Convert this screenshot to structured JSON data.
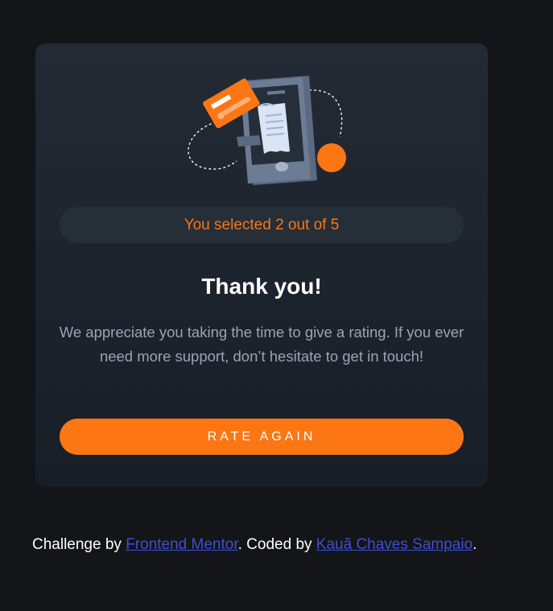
{
  "card": {
    "result_text": "You selected 2 out of 5",
    "title": "Thank you!",
    "description": "We appreciate you taking the time to give a rating. If you ever need more support, don’t hesitate to get in touch!",
    "button_label": "RATE AGAIN",
    "illustration_icon": "phone-receipt-card-illustration-icon"
  },
  "attribution": {
    "prefix": "Challenge by ",
    "link1": "Frontend Mentor",
    "middle": ". Coded by ",
    "link2": "Kauã Chaves Sampaio",
    "suffix": "."
  },
  "colors": {
    "background": "#131518",
    "accent": "#fc7614",
    "card": "#1f252e",
    "text_muted": "#9aa4b3",
    "link": "#3f4fd0"
  }
}
